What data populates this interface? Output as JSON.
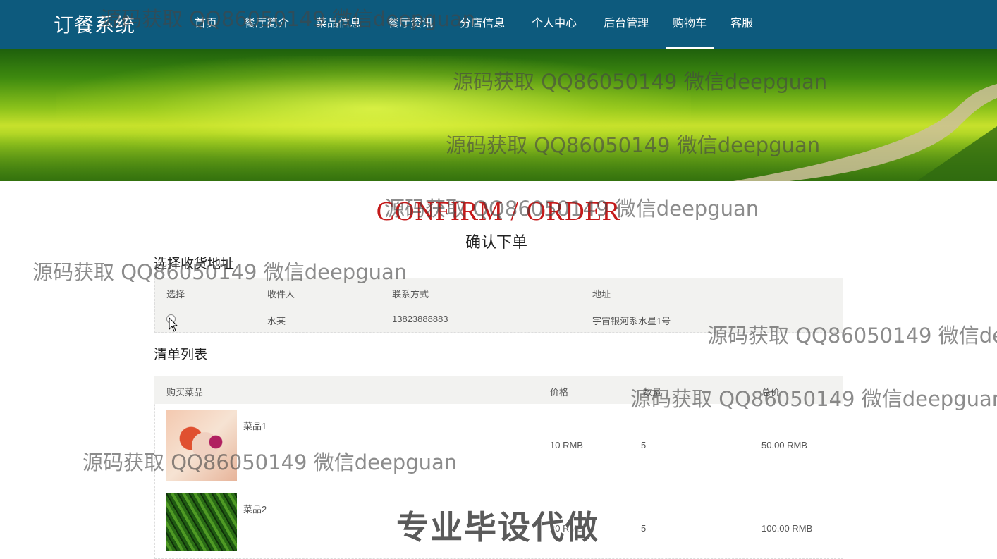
{
  "brand": "订餐系统",
  "nav": [
    {
      "label": "首页",
      "active": false
    },
    {
      "label": "餐厅简介",
      "active": false
    },
    {
      "label": "菜品信息",
      "active": false
    },
    {
      "label": "餐厅资讯",
      "active": false
    },
    {
      "label": "分店信息",
      "active": false
    },
    {
      "label": "个人中心",
      "active": false
    },
    {
      "label": "后台管理",
      "active": false
    },
    {
      "label": "购物车",
      "active": true
    },
    {
      "label": "客服",
      "active": false
    }
  ],
  "section": {
    "title_en": "CONFIRM / ORDER",
    "title_cn": "确认下单"
  },
  "address": {
    "heading": "选择收货地址",
    "columns": [
      "选择",
      "收件人",
      "联系方式",
      "地址"
    ],
    "rows": [
      {
        "name": "水某",
        "phone": "13823888883",
        "address": "宇宙银河系水星1号"
      }
    ]
  },
  "cart": {
    "heading": "清单列表",
    "columns": [
      "购买菜品",
      "价格",
      "数量",
      "总价"
    ],
    "items": [
      {
        "name": "菜品1",
        "price": "10 RMB",
        "qty": "5",
        "total": "50.00 RMB"
      },
      {
        "name": "菜品2",
        "price": "20 RMB",
        "qty": "5",
        "total": "100.00 RMB"
      }
    ]
  },
  "watermark": "源码获取 QQ86050149 微信deepguan",
  "stamp": "专业毕设代做",
  "colors": {
    "nav_bg": "#0d5a7d",
    "title_red": "#c41a1a",
    "table_bg": "#f2f2f0"
  }
}
